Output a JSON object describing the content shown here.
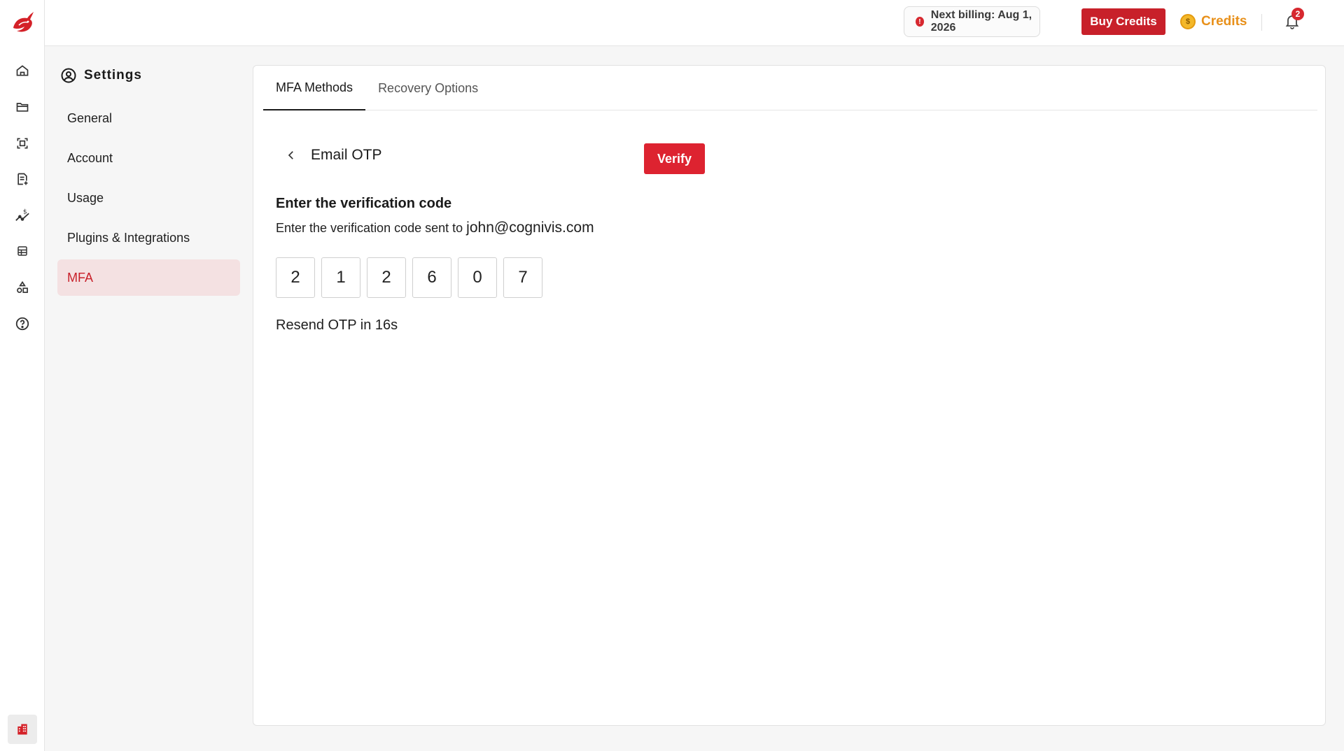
{
  "rail": {
    "logo": "brand-logo",
    "items": [
      {
        "icon": "home-icon"
      },
      {
        "icon": "folder-icon"
      },
      {
        "icon": "scan-frame-icon"
      },
      {
        "icon": "document-add-icon"
      },
      {
        "icon": "cost-chart-icon"
      },
      {
        "icon": "grid-table-icon"
      },
      {
        "icon": "shapes-icon"
      },
      {
        "icon": "help-circle-icon"
      }
    ],
    "bottom_icon": "building-icon"
  },
  "topbar": {
    "billing_text": "Next billing: Aug 1, 2026",
    "billing_icon": "!",
    "buy_credits_label": "Buy Credits",
    "credits_label": "Credits",
    "coin_symbol": "$",
    "notification_count": "2"
  },
  "settings": {
    "title": "Settings",
    "nav": [
      {
        "label": "General"
      },
      {
        "label": "Account"
      },
      {
        "label": "Usage"
      },
      {
        "label": "Plugins & Integrations"
      },
      {
        "label": "MFA",
        "active": true
      }
    ]
  },
  "main": {
    "tabs": [
      {
        "label": "MFA Methods",
        "active": true
      },
      {
        "label": "Recovery Options"
      }
    ],
    "method_title": "Email OTP",
    "verify_label": "Verify",
    "code_heading": "Enter the verification code",
    "code_sub_prefix": "Enter the verification code sent to",
    "email": "john@cognivis.com",
    "otp_digits": [
      "2",
      "1",
      "2",
      "6",
      "0",
      "7"
    ],
    "resend_text": "Resend OTP in 16s"
  },
  "colors": {
    "brand_red": "#c8202a",
    "verify_red": "#dd2330",
    "credits_orange": "#e8901a",
    "active_nav_bg": "#f4e1e2"
  }
}
